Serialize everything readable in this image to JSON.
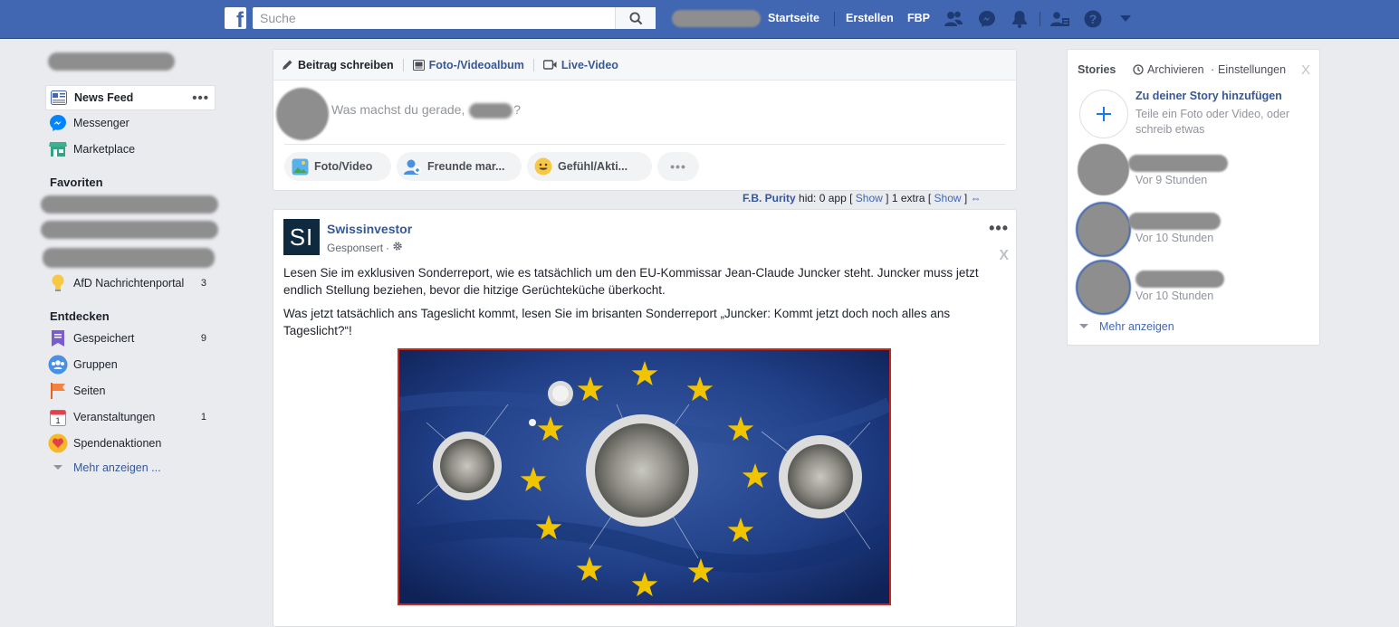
{
  "topbar": {
    "search_placeholder": "Suche",
    "links": [
      "Startseite",
      "Erstellen",
      "FBP"
    ]
  },
  "sidebar": {
    "news_feed": "News Feed",
    "messenger": "Messenger",
    "marketplace": "Marketplace",
    "favorites_heading": "Favoriten",
    "afd_label": "AfD Nachrichtenportal",
    "afd_count": "3",
    "discover_heading": "Entdecken",
    "discover": [
      {
        "label": "Gespeichert",
        "count": "9"
      },
      {
        "label": "Gruppen",
        "count": ""
      },
      {
        "label": "Seiten",
        "count": ""
      },
      {
        "label": "Veranstaltungen",
        "count": "1"
      },
      {
        "label": "Spendenaktionen",
        "count": ""
      }
    ],
    "more": "Mehr anzeigen ..."
  },
  "composer": {
    "tabs": [
      "Beitrag schreiben",
      "Foto-/Videoalbum",
      "Live-Video"
    ],
    "prompt_start": "Was machst du gerade,",
    "prompt_end": "?",
    "actions": [
      "Foto/Video",
      "Freunde mar...",
      "Gefühl/Akti..."
    ]
  },
  "fbpurity": {
    "brand": "F.B. Purity",
    "hid": "hid:",
    "app": "0 app [",
    "show1": "Show",
    "mid": "]  1 extra [",
    "show2": "Show",
    "end": "]"
  },
  "post": {
    "avatar_text": "SI",
    "author": "Swissinvestor",
    "sponsored": "Gesponsert",
    "close": "X",
    "paragraph1": "Lesen Sie im exklusiven Sonderreport, wie es tatsächlich um den EU-Kommissar Jean-Claude Juncker steht. Juncker muss jetzt endlich Stellung beziehen, bevor die hitzige Gerüchteküche überkocht.",
    "paragraph2": "Was jetzt tatsächlich ans Tageslicht kommt, lesen Sie im brisanten Sonderreport „Juncker: Kommt jetzt doch noch alles ans Tageslicht?“!"
  },
  "stories": {
    "title": "Stories",
    "archive": "Archivieren",
    "settings": "Einstellungen",
    "close": "X",
    "add_title": "Zu deiner Story hinzufügen",
    "add_desc": "Teile ein Foto oder Video, oder schreib etwas",
    "items": [
      {
        "time": "Vor 9 Stunden"
      },
      {
        "time": "Vor 10 Stunden"
      },
      {
        "time": "Vor 10 Stunden"
      }
    ],
    "more": "Mehr anzeigen"
  },
  "colors": {
    "brand_blue": "#4267b2",
    "link_blue": "#365899",
    "background": "#e9ebee",
    "image_border": "#c8271f"
  }
}
